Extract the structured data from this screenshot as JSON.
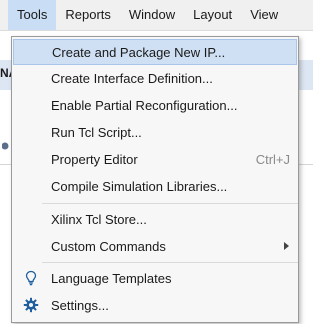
{
  "menubar": {
    "items": [
      {
        "label": "Tools"
      },
      {
        "label": "Reports"
      },
      {
        "label": "Window"
      },
      {
        "label": "Layout"
      },
      {
        "label": "View"
      }
    ]
  },
  "background": {
    "label": "NA"
  },
  "menu": {
    "items": [
      {
        "label": "Create and Package New IP..."
      },
      {
        "label": "Create Interface Definition..."
      },
      {
        "label": "Enable Partial Reconfiguration..."
      },
      {
        "label": "Run Tcl Script..."
      },
      {
        "label": "Property Editor",
        "shortcut": "Ctrl+J"
      },
      {
        "label": "Compile Simulation Libraries..."
      },
      {
        "label": "Xilinx Tcl Store..."
      },
      {
        "label": "Custom Commands"
      },
      {
        "label": "Language Templates",
        "icon": "lightbulb-icon"
      },
      {
        "label": "Settings...",
        "icon": "gear-icon"
      }
    ]
  },
  "colors": {
    "highlight": "#cfe0f4",
    "menubar_active": "#c9def5",
    "icon_blue": "#1f5f9e"
  }
}
